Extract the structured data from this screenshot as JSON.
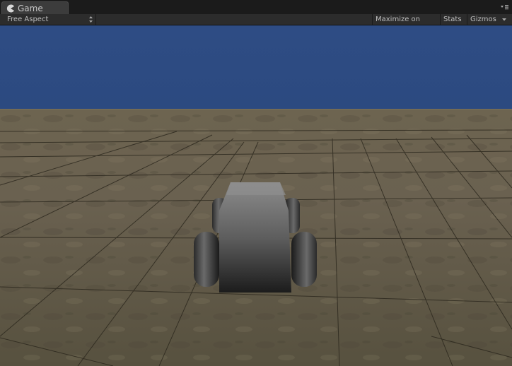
{
  "tab": {
    "label": "Game",
    "icon": "pacman-icon"
  },
  "toolbar": {
    "aspect_label": "Free Aspect",
    "maximize_label": "Maximize on Play",
    "stats_label": "Stats",
    "gizmos_label": "Gizmos"
  },
  "colors": {
    "sky": "#2c4b80",
    "ground": "#6f6550",
    "car_body": "#7a7a7a",
    "panel": "#2c2c2c"
  }
}
